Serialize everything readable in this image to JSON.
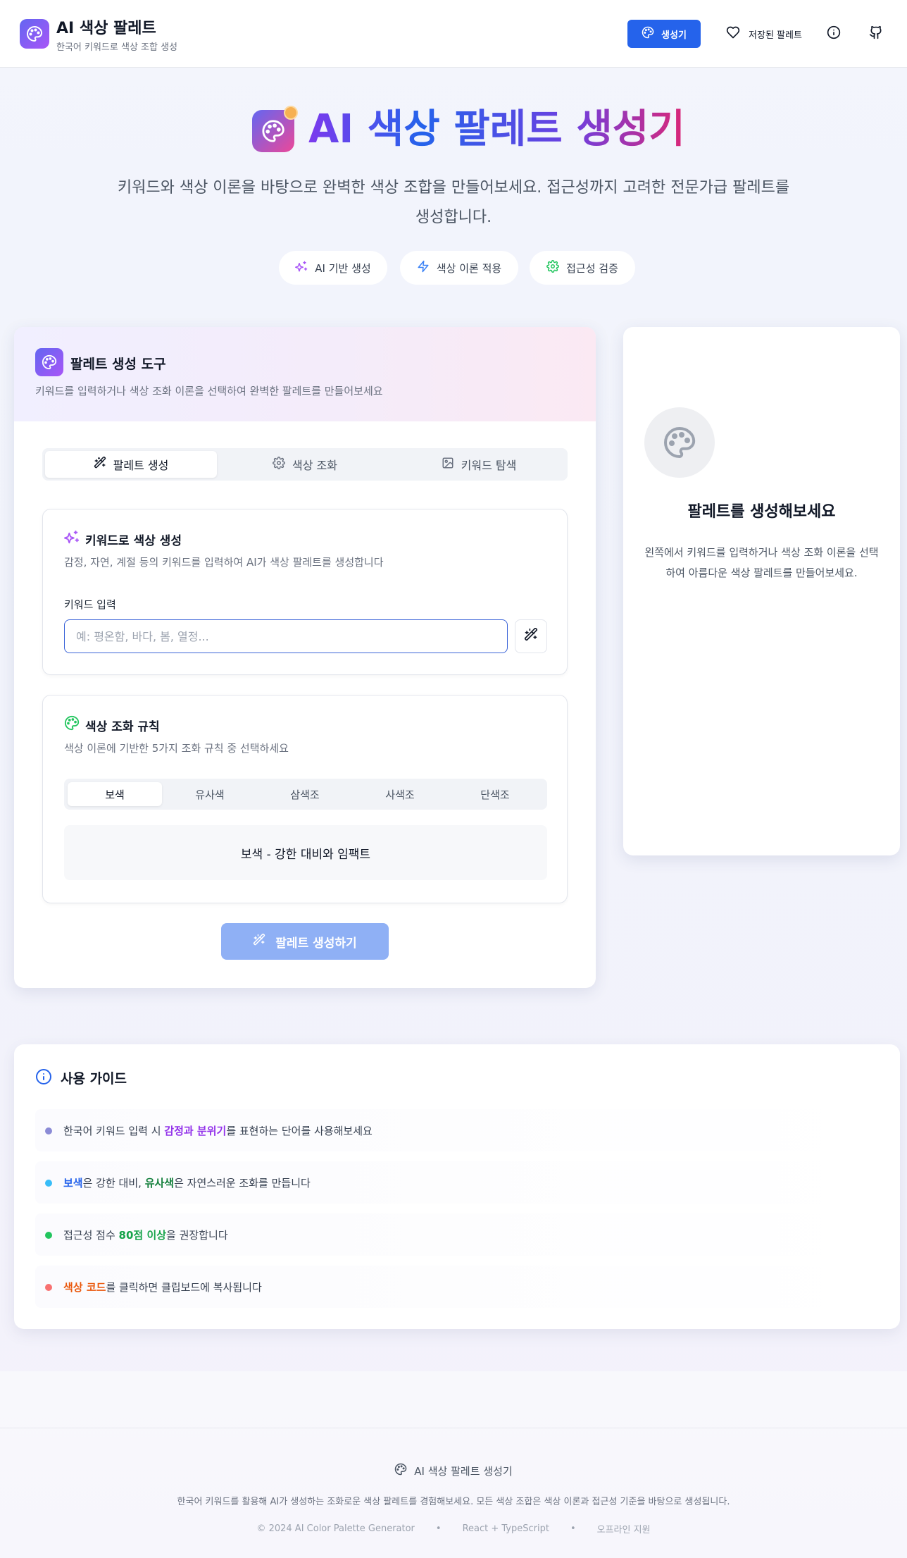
{
  "header": {
    "title": "AI 색상 팔레트",
    "subtitle": "한국어 키워드로 색상 조합 생성",
    "nav": {
      "generator": "생성기",
      "saved": "저장된 팔레트"
    }
  },
  "hero": {
    "title": "AI 색상 팔레트 생성기",
    "description": "키워드와 색상 이론을 바탕으로 완벽한 색상 조합을 만들어보세요. 접근성까지 고려한 전문가급 팔레트를 생성합니다.",
    "pills": [
      "AI 기반 생성",
      "색상 이론 적용",
      "접근성 검증"
    ]
  },
  "tool": {
    "title": "팔레트 생성 도구",
    "subtitle": "키워드를 입력하거나 색상 조화 이론을 선택하여 완벽한 팔레트를 만들어보세요",
    "tabs": [
      "팔레트 생성",
      "색상 조화",
      "키워드 탐색"
    ],
    "keyword_section": {
      "title": "키워드로 색상 생성",
      "description": "감정, 자연, 계절 등의 키워드를 입력하여 AI가 색상 팔레트를 생성합니다",
      "input_label": "키워드 입력",
      "input_placeholder": "예: 평온함, 바다, 봄, 열정...",
      "input_value": ""
    },
    "harmony_section": {
      "title": "색상 조화 규칙",
      "description": "색상 이론에 기반한 5가지 조화 규칙 중 선택하세요",
      "rules": [
        "보색",
        "유사색",
        "삼색조",
        "사색조",
        "단색조"
      ],
      "selected": "보색",
      "selected_description": "보색 - 강한 대비와 임팩트"
    },
    "generate_button": "팔레트 생성하기"
  },
  "preview": {
    "title": "팔레트를 생성해보세요",
    "description": "왼쪽에서 키워드를 입력하거나 색상 조화 이론을 선택하여 아름다운 색상 팔레트를 만들어보세요."
  },
  "guide": {
    "title": "사용 가이드",
    "items": [
      {
        "pre": "한국어 키워드 입력 시 ",
        "hl": "감정과 분위기",
        "post": "를 표현하는 단어를 사용해보세요",
        "hl_color": "#9333ea",
        "dot": "#8b8bd6"
      },
      {
        "pre": "",
        "hl": "보색",
        "mid": "은 강한 대비, ",
        "hl2": "유사색",
        "post": "은 자연스러운 조화를 만듭니다",
        "hl_color": "#2563eb",
        "hl2_color": "#15803d",
        "dot": "#38bdf8"
      },
      {
        "pre": "접근성 점수 ",
        "hl": "80점 이상",
        "post": "을 권장합니다",
        "hl_color": "#16a34a",
        "dot": "#22c55e"
      },
      {
        "pre": "",
        "hl": "색상 코드",
        "post": "를 클릭하면 클립보드에 복사됩니다",
        "hl_color": "#ea580c",
        "dot": "#f87171"
      }
    ]
  },
  "footer": {
    "title": "AI 색상 팔레트 생성기",
    "description": "한국어 키워드를 활용해 AI가 생성하는 조화로운 색상 팔레트를 경험해보세요. 모든 색상 조합은 색상 이론과 접근성 기준을 바탕으로 생성됩니다.",
    "meta": [
      "© 2024 AI Color Palette Generator",
      "React + TypeScript",
      "오프라인 지원"
    ]
  },
  "colors": {
    "primary": "#2563eb",
    "primary_disabled": "#8fb0f5",
    "brand_gradient_start": "#6366f1",
    "brand_gradient_end": "#a855f7"
  }
}
